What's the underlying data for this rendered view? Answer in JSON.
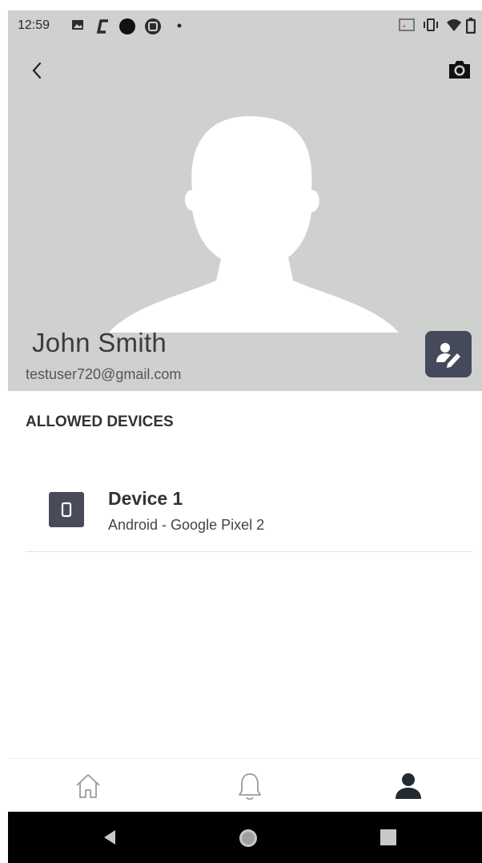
{
  "status_bar": {
    "time": "12:59",
    "left_icons": [
      "image-icon",
      "c-logo-icon",
      "circle-icon",
      "app-badge-icon",
      "dot-icon"
    ],
    "right_icons": [
      "cast-icon",
      "vibrate-icon",
      "wifi-icon",
      "battery-icon"
    ]
  },
  "header": {
    "back_icon": "chevron-left-icon",
    "camera_icon": "camera-icon",
    "background_color": "#cfd0d0"
  },
  "profile": {
    "name": "John  Smith",
    "email": "testuser720@gmail.com",
    "edit_icon": "edit-profile-icon",
    "edit_button_color": "#454a5a"
  },
  "devices": {
    "section_title": "ALLOWED DEVICES",
    "items": [
      {
        "name": "Device  1",
        "detail": "Android - Google Pixel 2",
        "icon": "smartphone-icon"
      }
    ]
  },
  "bottom_nav": {
    "items": [
      {
        "icon": "home-icon",
        "active": false
      },
      {
        "icon": "bell-icon",
        "active": false
      },
      {
        "icon": "profile-icon",
        "active": true
      }
    ],
    "active_color": "#222a33",
    "inactive_color": "#9a9a9a"
  },
  "system_nav": [
    "back-triangle-icon",
    "home-circle-icon",
    "recents-square-icon"
  ]
}
